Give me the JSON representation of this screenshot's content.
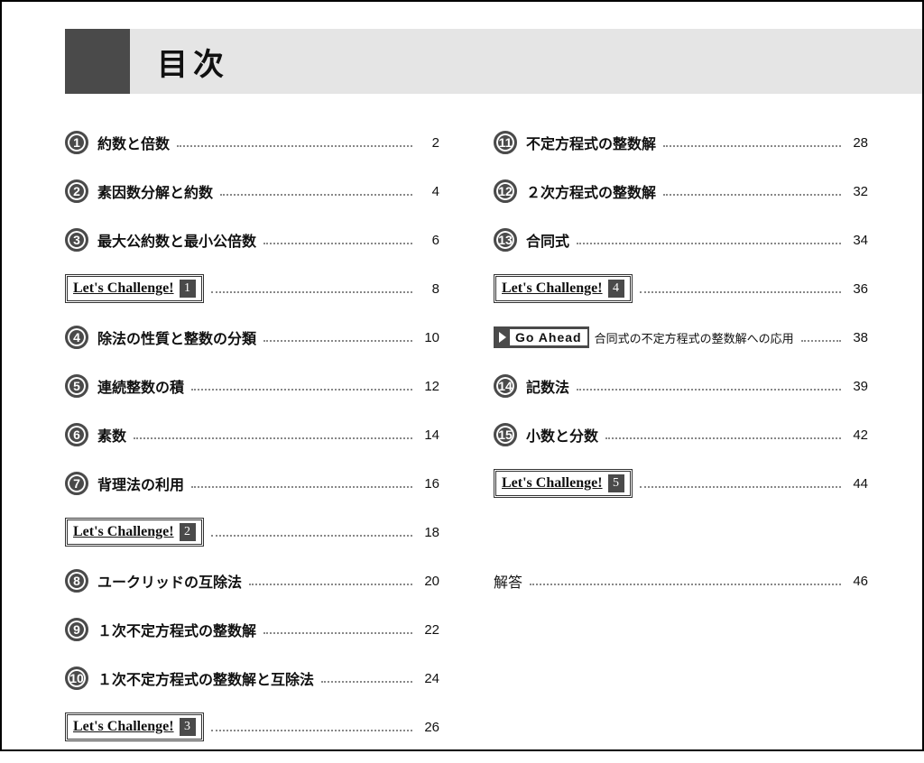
{
  "header": {
    "title": "目次"
  },
  "challenge_label": "Let's Challenge!",
  "goahead_label": "Go Ahead",
  "left": [
    {
      "type": "num",
      "num": "1",
      "title": "約数と倍数",
      "page": "2"
    },
    {
      "type": "num",
      "num": "2",
      "title": "素因数分解と約数",
      "page": "4"
    },
    {
      "type": "num",
      "num": "3",
      "title": "最大公約数と最小公倍数",
      "page": "6"
    },
    {
      "type": "challenge",
      "idx": "1",
      "page": "8"
    },
    {
      "type": "num",
      "num": "4",
      "title": "除法の性質と整数の分類",
      "page": "10"
    },
    {
      "type": "num",
      "num": "5",
      "title": "連続整数の積",
      "page": "12"
    },
    {
      "type": "num",
      "num": "6",
      "title": "素数",
      "page": "14"
    },
    {
      "type": "num",
      "num": "7",
      "title": "背理法の利用",
      "page": "16"
    },
    {
      "type": "challenge",
      "idx": "2",
      "page": "18"
    },
    {
      "type": "num",
      "num": "8",
      "title": "ユークリッドの互除法",
      "page": "20"
    },
    {
      "type": "num",
      "num": "9",
      "title": "１次不定方程式の整数解",
      "page": "22"
    },
    {
      "type": "num",
      "num": "10",
      "title": "１次不定方程式の整数解と互除法",
      "page": "24"
    },
    {
      "type": "challenge",
      "idx": "3",
      "page": "26"
    }
  ],
  "right": [
    {
      "type": "num",
      "num": "11",
      "title": "不定方程式の整数解",
      "page": "28"
    },
    {
      "type": "num",
      "num": "12",
      "title": "２次方程式の整数解",
      "page": "32"
    },
    {
      "type": "num",
      "num": "13",
      "title": "合同式",
      "page": "34"
    },
    {
      "type": "challenge",
      "idx": "4",
      "page": "36"
    },
    {
      "type": "goahead",
      "sub": "合同式の不定方程式の整数解への応用",
      "page": "38"
    },
    {
      "type": "num",
      "num": "14",
      "title": "記数法",
      "page": "39"
    },
    {
      "type": "num",
      "num": "15",
      "title": "小数と分数",
      "page": "42"
    },
    {
      "type": "challenge",
      "idx": "5",
      "page": "44"
    },
    {
      "type": "spacer"
    },
    {
      "type": "plain",
      "title": "解答",
      "page": "46"
    }
  ]
}
